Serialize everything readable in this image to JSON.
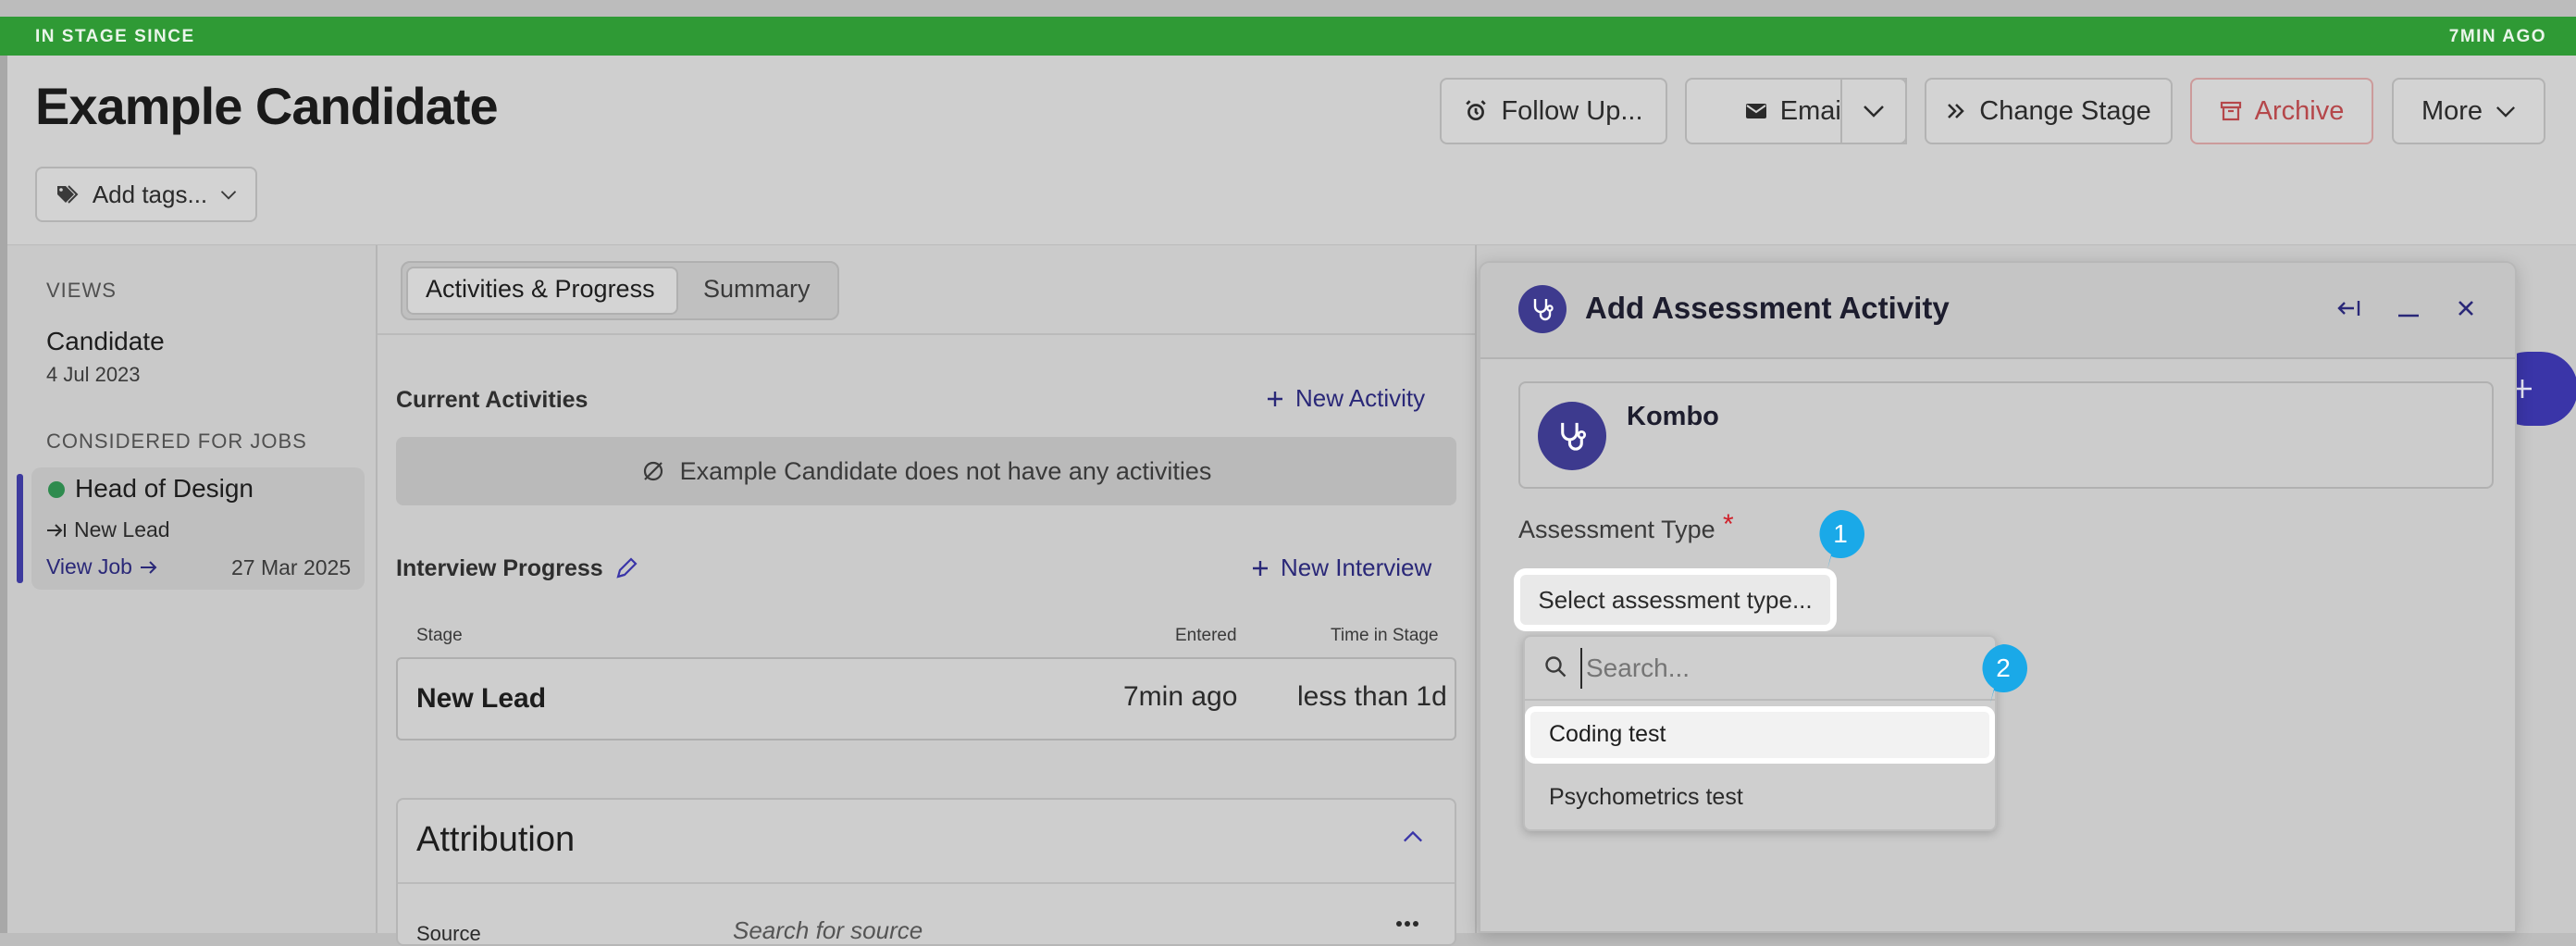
{
  "banner": {
    "left": "IN STAGE SINCE",
    "right": "7MIN AGO"
  },
  "candidate": {
    "name": "Example Candidate",
    "add_tags": "Add tags..."
  },
  "actions": {
    "follow_up": "Follow Up...",
    "email": "Email",
    "change_stage": "Change Stage",
    "archive": "Archive",
    "more": "More"
  },
  "colors": {
    "banner_green": "#2f9a35",
    "accent_indigo": "#3d3a8e",
    "badge_blue": "#1aa9e8",
    "archive_red": "#b5474a",
    "status_green": "#2e8b4e"
  },
  "sidebar": {
    "views_caption": "VIEWS",
    "view_name": "Candidate",
    "view_date": "4 Jul 2023",
    "jobs_caption": "CONSIDERED FOR JOBS",
    "job_title": "Head of Design",
    "job_stage": "New Lead",
    "view_job": "View Job",
    "job_date": "27 Mar 2025"
  },
  "tabs": [
    "Activities & Progress",
    "Summary"
  ],
  "activities": {
    "title": "Current Activities",
    "new_activity": "New Activity",
    "empty_text": "Example Candidate does not have any activities"
  },
  "interview": {
    "title": "Interview Progress",
    "new_interview": "New Interview",
    "col_stage": "Stage",
    "col_entered": "Entered",
    "col_time": "Time in Stage",
    "row": {
      "stage": "New Lead",
      "entered": "7min ago",
      "time": "less than 1d"
    }
  },
  "attribution": {
    "title": "Attribution",
    "source_label": "Source",
    "source_placeholder": "Search for source"
  },
  "panel": {
    "title": "Add Assessment Activity",
    "provider": "Kombo",
    "field_label": "Assessment Type",
    "required_mark": "*",
    "select_placeholder": "Select assessment type...",
    "search_placeholder": "Search...",
    "options": [
      "Coding test",
      "Psychometrics test"
    ]
  },
  "icons": [
    "alarm-clock-icon",
    "envelope-icon",
    "chevron-down-icon",
    "double-chevron-right-icon",
    "archive-box-icon",
    "tag-icon",
    "stethoscope-icon",
    "collapse-left-icon",
    "minimize-icon",
    "close-icon",
    "plus-icon",
    "pencil-icon",
    "empty-set-icon",
    "search-icon",
    "arrow-right-icon",
    "chevron-up-icon",
    "more-horizontal-icon"
  ],
  "badges": [
    "1",
    "2"
  ]
}
